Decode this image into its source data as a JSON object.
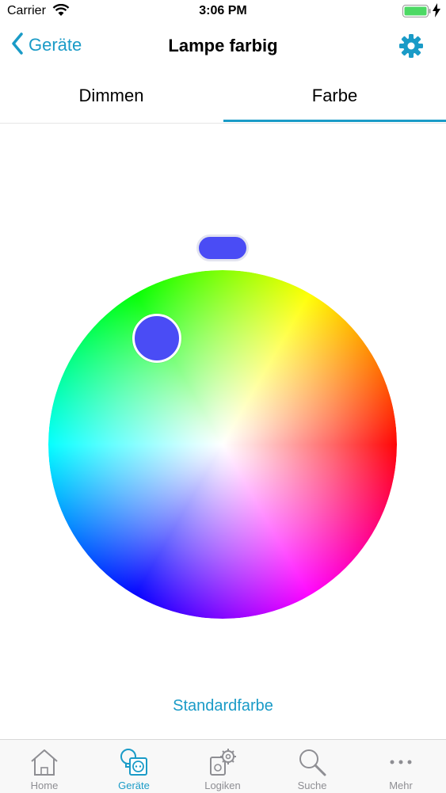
{
  "status_bar": {
    "carrier": "Carrier",
    "time": "3:06 PM"
  },
  "nav": {
    "back_label": "Geräte",
    "title": "Lampe farbig"
  },
  "tabs": [
    {
      "label": "Dimmen",
      "selected": false
    },
    {
      "label": "Farbe",
      "selected": true
    }
  ],
  "color_picker": {
    "selected_color": "#4a4cf5"
  },
  "standard_color_label": "Standardfarbe",
  "tab_bar": [
    {
      "label": "Home",
      "icon": "house-icon",
      "active": false
    },
    {
      "label": "Geräte",
      "icon": "devices-icon",
      "active": true
    },
    {
      "label": "Logiken",
      "icon": "logic-gear-icon",
      "active": false
    },
    {
      "label": "Suche",
      "icon": "search-icon",
      "active": false
    },
    {
      "label": "Mehr",
      "icon": "more-icon",
      "active": false
    }
  ],
  "colors": {
    "accent": "#1a9bc7",
    "inactive": "#8e8e93"
  }
}
